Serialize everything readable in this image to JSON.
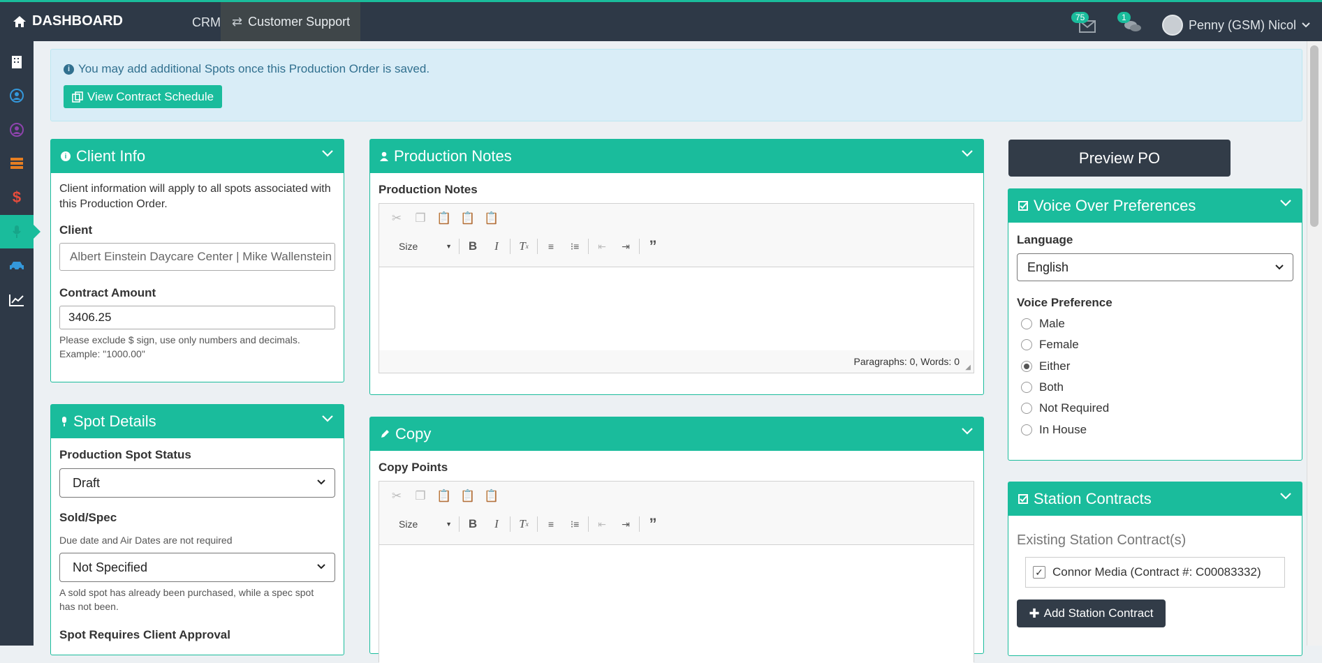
{
  "topbar": {
    "brand": "DASHBOARD",
    "nav_crm": "CRM",
    "nav_customer_support": "Customer Support",
    "mail_count": "75",
    "chat_count": "1",
    "user_name": "Penny (GSM) Nicol"
  },
  "alert": {
    "message": "You may add additional Spots once this Production Order is saved.",
    "button": "View Contract Schedule"
  },
  "client_info": {
    "title": "Client Info",
    "description": "Client information will apply to all spots associated with this Production Order.",
    "client_label": "Client",
    "client_value": "Albert Einstein Daycare Center | Mike Wallenstein",
    "amount_label": "Contract Amount",
    "amount_value": "3406.25",
    "amount_help": "Please exclude $ sign, use only numbers and decimals. Example: \"1000.00\""
  },
  "spot_details": {
    "title": "Spot Details",
    "status_label": "Production Spot Status",
    "status_value": "Draft",
    "soldspec_label": "Sold/Spec",
    "soldspec_help": "Due date and Air Dates are not required",
    "soldspec_value": "Not Specified",
    "soldspec_note": "A sold spot has already been purchased, while a spec spot has not been.",
    "approval_label": "Spot Requires Client Approval"
  },
  "production_notes": {
    "title": "Production Notes",
    "field_label": "Production Notes",
    "size_label": "Size",
    "status": "Paragraphs: 0, Words: 0"
  },
  "copy": {
    "title": "Copy",
    "field_label": "Copy Points",
    "size_label": "Size"
  },
  "preview_button": "Preview PO",
  "voice_over": {
    "title": "Voice Over Preferences",
    "language_label": "Language",
    "language_value": "English",
    "preference_label": "Voice Preference",
    "options": [
      "Male",
      "Female",
      "Either",
      "Both",
      "Not Required",
      "In House"
    ],
    "selected": "Either"
  },
  "station_contracts": {
    "title": "Station Contracts",
    "existing_label": "Existing Station Contract(s)",
    "contract": "Connor Media (Contract #: C00083332)",
    "add_button": "Add Station Contract"
  }
}
